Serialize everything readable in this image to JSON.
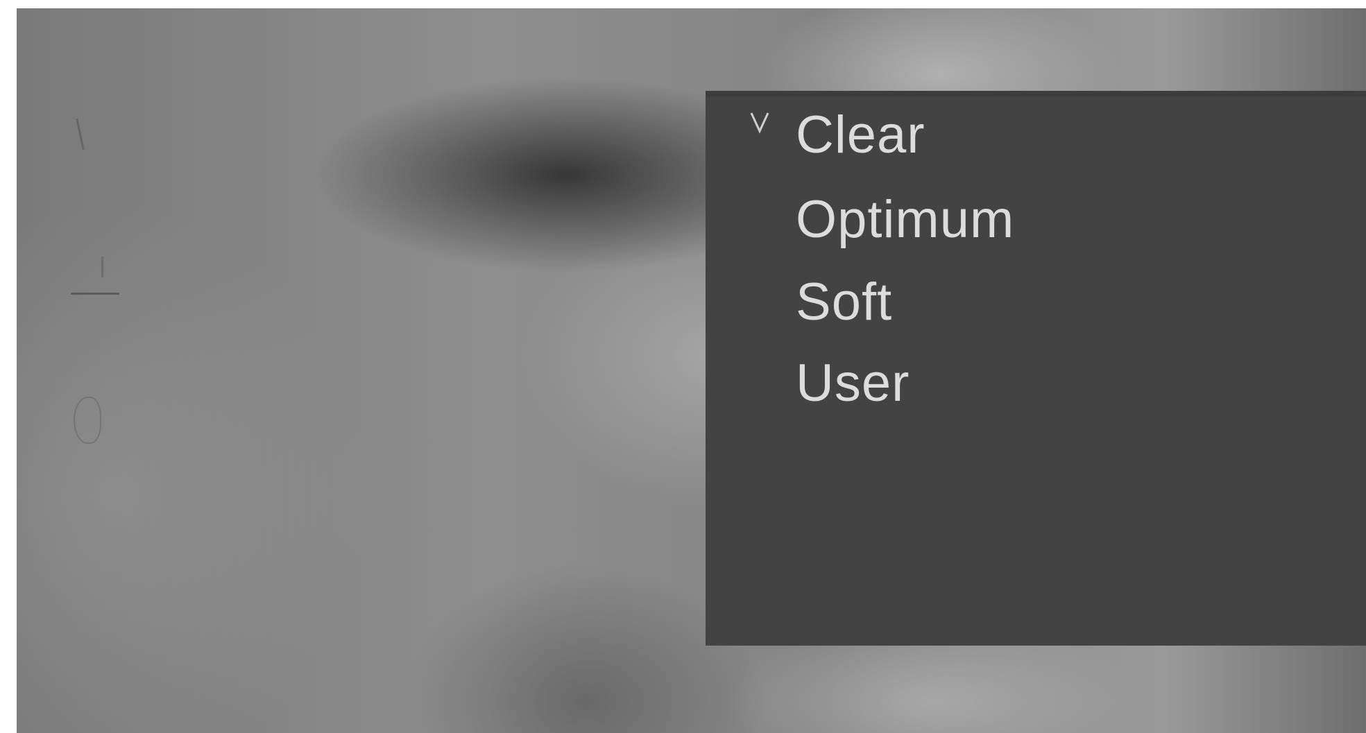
{
  "menu": {
    "items": [
      {
        "label": "Clear",
        "selected": true
      },
      {
        "label": "Optimum",
        "selected": false
      },
      {
        "label": "Soft",
        "selected": false
      },
      {
        "label": "User",
        "selected": false
      }
    ],
    "selected_marker_icon": "check-v-icon"
  },
  "colors": {
    "menu_background": "#434343",
    "menu_text": "#dcdcdc"
  }
}
